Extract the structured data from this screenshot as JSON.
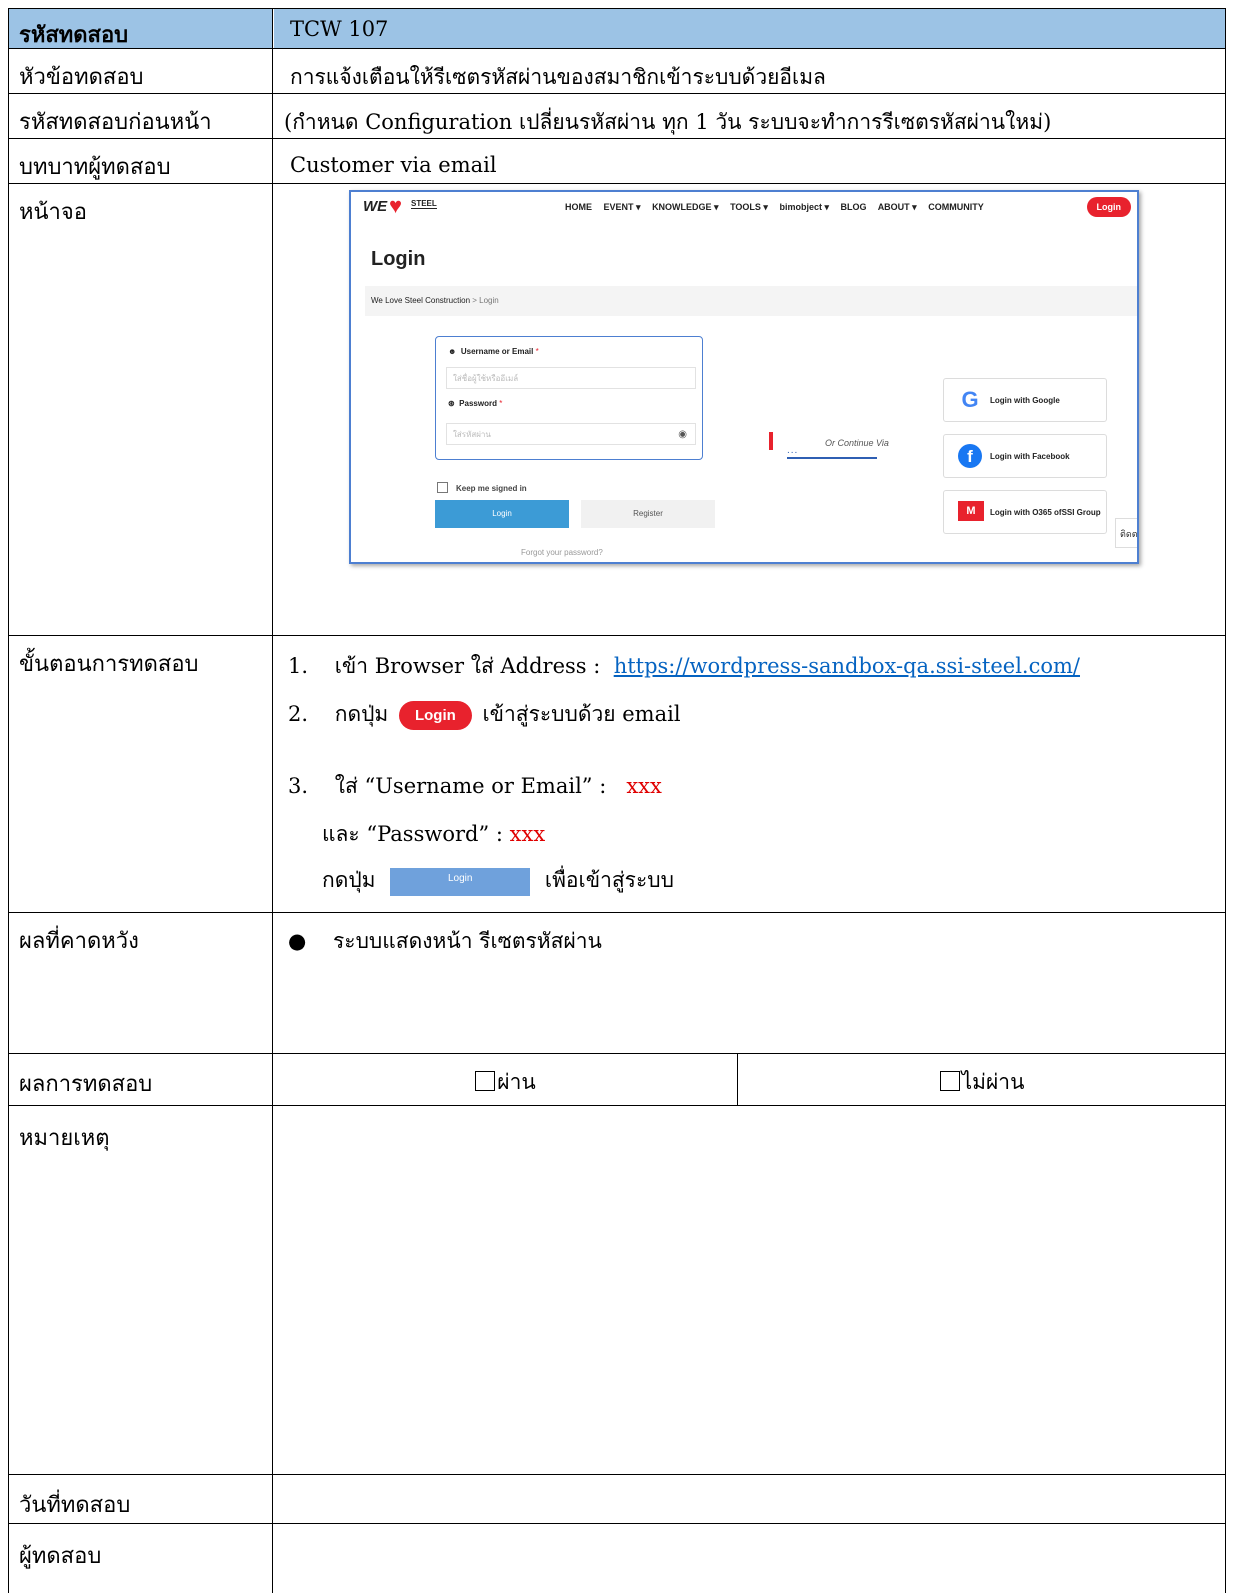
{
  "header": {
    "label": "รหัสทดสอบ",
    "value": "TCW 107"
  },
  "rows": {
    "topic": {
      "label": "หัวข้อทดสอบ",
      "value": "การแจ้งเตือนให้รีเซตรหัสผ่านของสมาชิกเข้าระบบด้วยอีเมล"
    },
    "prereq": {
      "label": "รหัสทดสอบก่อนหน้า",
      "value": "(กำหนด Configuration เปลี่ยนรหัสผ่าน ทุก 1 วัน ระบบจะทำการรีเซตรหัสผ่านใหม่)"
    },
    "role": {
      "label": "บทบาทผู้ทดสอบ",
      "value": "Customer via email"
    },
    "screen": {
      "label": "หน้าจอ"
    },
    "steps": {
      "label": "ขั้นตอนการทดสอบ"
    },
    "expected": {
      "label": "ผลที่คาดหวัง",
      "value": "ระบบแสดงหน้า รีเซตรหัสผ่าน"
    },
    "result": {
      "label": "ผลการทดสอบ",
      "pass": "ผ่าน",
      "fail": "ไม่ผ่าน"
    },
    "note": {
      "label": "หมายเหตุ"
    },
    "date": {
      "label": "วันที่ทดสอบ"
    },
    "tester": {
      "label": "ผู้ทดสอบ"
    }
  },
  "steps": {
    "s1_num": "1.",
    "s1_text": "เข้า Browser ใส่ Address :",
    "s1_link": "https://wordpress-sandbox-qa.ssi-steel.com/",
    "s2_num": "2.",
    "s2_pre": "กดปุ่ม",
    "s2_button": "Login",
    "s2_post": "เข้าสู่ระบบด้วย email",
    "s3_num": "3.",
    "s3_text": "ใส่ “Username or Email” :",
    "s3_val": "xxx",
    "s3b_text": "และ “Password” :",
    "s3b_val": "xxx",
    "s3c_pre": "กดปุ่ม",
    "s3c_button": "Login",
    "s3c_post": "เพื่อเข้าสู่ระบบ"
  },
  "screenshot": {
    "logo": "WE",
    "logo_steel": "STEEL",
    "nav": [
      "HOME",
      "EVENT ▾",
      "KNOWLEDGE ▾",
      "TOOLS ▾",
      "bimobject ▾",
      "BLOG",
      "ABOUT ▾",
      "COMMUNITY"
    ],
    "nav_login": "Login",
    "title": "Login",
    "breadcrumb_home": "We Love Steel Construction",
    "breadcrumb_sep": " > ",
    "breadcrumb_current": "Login",
    "username_label": "Username or Email",
    "username_placeholder": "ใส่ชื่อผู้ใช้หรืออีเมล์",
    "password_label": "Password",
    "password_placeholder": "ใส่รหัสผ่าน",
    "required": "*",
    "keep_signed": "Keep me signed in",
    "login_btn": "Login",
    "register_btn": "Register",
    "forgot": "Forgot your password?",
    "or_continue": "Or Continue Via",
    "google": "Login with Google",
    "facebook": "Login with Facebook",
    "o365_line1": "Login with O365 of",
    "o365_line2": "SSI Group",
    "edge_text": "ติดต"
  }
}
